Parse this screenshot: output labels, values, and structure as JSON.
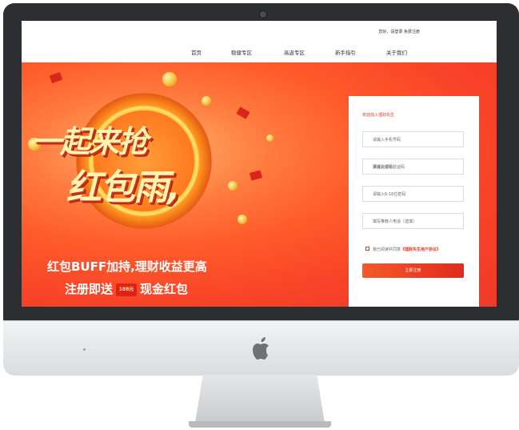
{
  "topbar": {
    "greeting": "您好，请登录  免费注册"
  },
  "nav": {
    "items": [
      "首页",
      "稳健专区",
      "高返专区",
      "新手指引",
      "关于我们"
    ]
  },
  "banner": {
    "headline_line1": "一起来抢",
    "headline_line2": "红包雨,",
    "subline1": "红包BUFF加持,理财收益更高",
    "subline2_prefix": "注册即送",
    "redpack_amount": "188元",
    "subline2_suffix": "现金红包"
  },
  "form": {
    "title": "欢迎加入理财先生",
    "phone_placeholder": "请输入手机号码",
    "sms_placeholder": "请输入短信验证码",
    "sms_button": "发送验证码",
    "password_placeholder": "请输入6-16位密码",
    "referrer_placeholder": "填写推荐人电话（选填）",
    "agree_prefix": "我已阅读并同意",
    "agree_link": "《理财先生用户协议》",
    "submit_label": "立即注册"
  },
  "colors": {
    "accent": "#e0391f",
    "banner": "#f84328",
    "bezel": "#2c2e31"
  }
}
